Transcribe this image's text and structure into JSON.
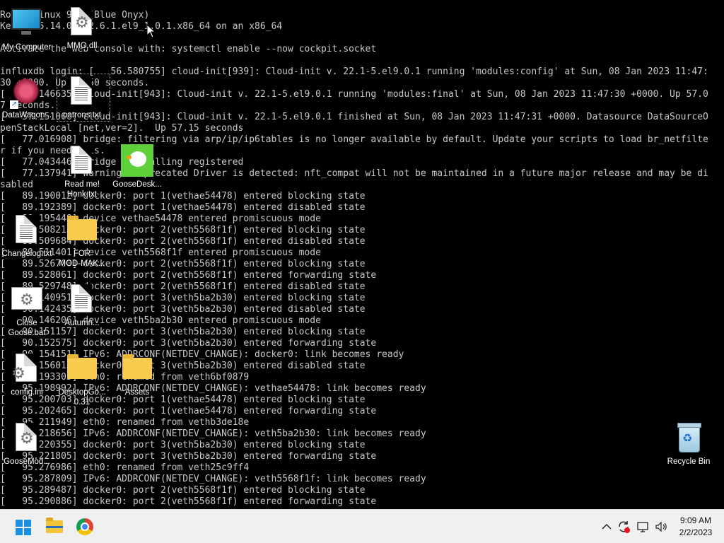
{
  "console": {
    "lines": [
      "Rocky Linux 9.1 (Blue Onyx)",
      "Kernel 5.14.0-162.6.1.el9_1.0.1.x86_64 on an x86_64",
      "",
      "Activate the web console with: systemctl enable --now cockpit.socket",
      "",
      "influxdb login: [   56.580755] cloud-init[939]: Cloud-init v. 22.1-5.el9.0.1 running 'modules:config' at Sun, 08 Jan 2023 11:47:",
      "30 +0000. Up 56.50 seconds.",
      "[   57.146635] cloud-init[943]: Cloud-init v. 22.1-5.el9.0.1 running 'modules:final' at Sun, 08 Jan 2023 11:47:30 +0000. Up 57.0",
      "7 seconds.",
      "[   57.151066] cloud-init[943]: Cloud-init v. 22.1-5.el9.0.1 finished at Sun, 08 Jan 2023 11:47:31 +0000. Datasource DataSourceO",
      "penStackLocal [net,ver=2].  Up 57.15 seconds",
      "[   77.016908] bridge: filtering via arp/ip/ip6tables is no longer available by default. Update your scripts to load br_netfilte",
      "r if you need this.",
      "[   77.043446] Bridge firewalling registered",
      "[   77.137941] Warning: Deprecated Driver is detected: nft_compat will not be maintained in a future major release and may be di",
      "sabled",
      "[   89.190012] docker0: port 1(vethae54478) entered blocking state",
      "[   89.192389] docker0: port 1(vethae54478) entered disabled state",
      "[   89.195448] device vethae54478 entered promiscuous mode",
      "[   89.508213] docker0: port 2(veth5568f1f) entered blocking state",
      "[   89.509684] docker0: port 2(veth5568f1f) entered disabled state",
      "[   89.511401] device veth5568f1f entered promiscuous mode",
      "[   89.526700] docker0: port 2(veth5568f1f) entered blocking state",
      "[   89.528061] docker0: port 2(veth5568f1f) entered forwarding state",
      "[   89.529748] docker0: port 2(veth5568f1f) entered disabled state",
      "[   90.140951] docker0: port 3(veth5ba2b30) entered blocking state",
      "[   90.142435] docker0: port 3(veth5ba2b30) entered disabled state",
      "[   90.146206] device veth5ba2b30 entered promiscuous mode",
      "[   90.151157] docker0: port 3(veth5ba2b30) entered blocking state",
      "[   90.152575] docker0: port 3(veth5ba2b30) entered forwarding state",
      "[   90.154151] IPv6: ADDRCONF(NETDEV_CHANGE): docker0: link becomes ready",
      "[   90.156015] docker0: port 3(veth5ba2b30) entered disabled state",
      "[   95.193305] eth0: renamed from veth6bf0879",
      "[   95.198992] IPv6: ADDRCONF(NETDEV_CHANGE): vethae54478: link becomes ready",
      "[   95.200703] docker0: port 1(vethae54478) entered blocking state",
      "[   95.202465] docker0: port 1(vethae54478) entered forwarding state",
      "[   95.211949] eth0: renamed from vethb3de18e",
      "[   95.218656] IPv6: ADDRCONF(NETDEV_CHANGE): veth5ba2b30: link becomes ready",
      "[   95.220355] docker0: port 3(veth5ba2b30) entered blocking state",
      "[   95.221805] docker0: port 3(veth5ba2b30) entered forwarding state",
      "[   95.276986] eth0: renamed from veth25c9ff4",
      "[   95.287809] IPv6: ADDRCONF(NETDEV_CHANGE): veth5568f1f: link becomes ready",
      "[   95.289487] docker0: port 2(veth5568f1f) entered blocking state",
      "[   95.290886] docker0: port 2(veth5568f1f) entered forwarding state"
    ]
  },
  "desktop_icons": {
    "my_computer": {
      "label": "My Computer",
      "icon": "monitor-icon"
    },
    "mmo_dll": {
      "label": "MMO.dll",
      "icon": "settings-file-icon"
    },
    "data_wagon": {
      "label": "DataWagon...",
      "icon": "virus-shortcut-icon"
    },
    "patrons_txt": {
      "label": "patrons.txt",
      "icon": "text-file-icon"
    },
    "read_me": {
      "label": "Read me!",
      "label2": "Honk.txt",
      "icon": "text-file-icon"
    },
    "goose_desk": {
      "label": "GooseDesk...",
      "icon": "goose-icon"
    },
    "changelog": {
      "label": "Changelog.txt",
      "icon": "text-file-icon"
    },
    "for_mod_makers": {
      "label": "FOR",
      "label2": "MOD-MAK...",
      "icon": "folder-icon"
    },
    "close_goose": {
      "label": "Close",
      "label2": "Goose.bat",
      "icon": "settings-file-icon"
    },
    "autumn": {
      "label": "Autumn...",
      "icon": "text-file-icon"
    },
    "config_ini": {
      "label": "config.ini",
      "icon": "config-file-icon"
    },
    "desktop_goose": {
      "label": "DesktopGo...",
      "label2": "0.31",
      "icon": "folder-icon"
    },
    "assets": {
      "label": "Assets",
      "icon": "folder-icon"
    },
    "goose_mod": {
      "label": "GooseMod...",
      "icon": "settings-file-icon"
    },
    "recycle_bin": {
      "label": "Recycle Bin",
      "icon": "recycle-bin-icon"
    }
  },
  "taskbar": {
    "start": {
      "icon": "windows-start-icon"
    },
    "pinned": [
      {
        "name": "File Explorer",
        "icon": "folder-icon"
      },
      {
        "name": "Google Chrome",
        "icon": "chrome-icon"
      }
    ],
    "tray": {
      "chevron": "^",
      "icons": [
        "chevron-up-icon",
        "sync-error-icon",
        "network-icon",
        "volume-icon"
      ]
    },
    "clock": {
      "time": "9:09 AM",
      "date": "2/2/2023"
    }
  },
  "colors": {
    "console_text": "#c8c8c8",
    "console_bg": "#000000",
    "taskbar_bg": "#f0f0f0",
    "folder": "#f8cd4f",
    "start_blue": "#1a8fe3"
  }
}
